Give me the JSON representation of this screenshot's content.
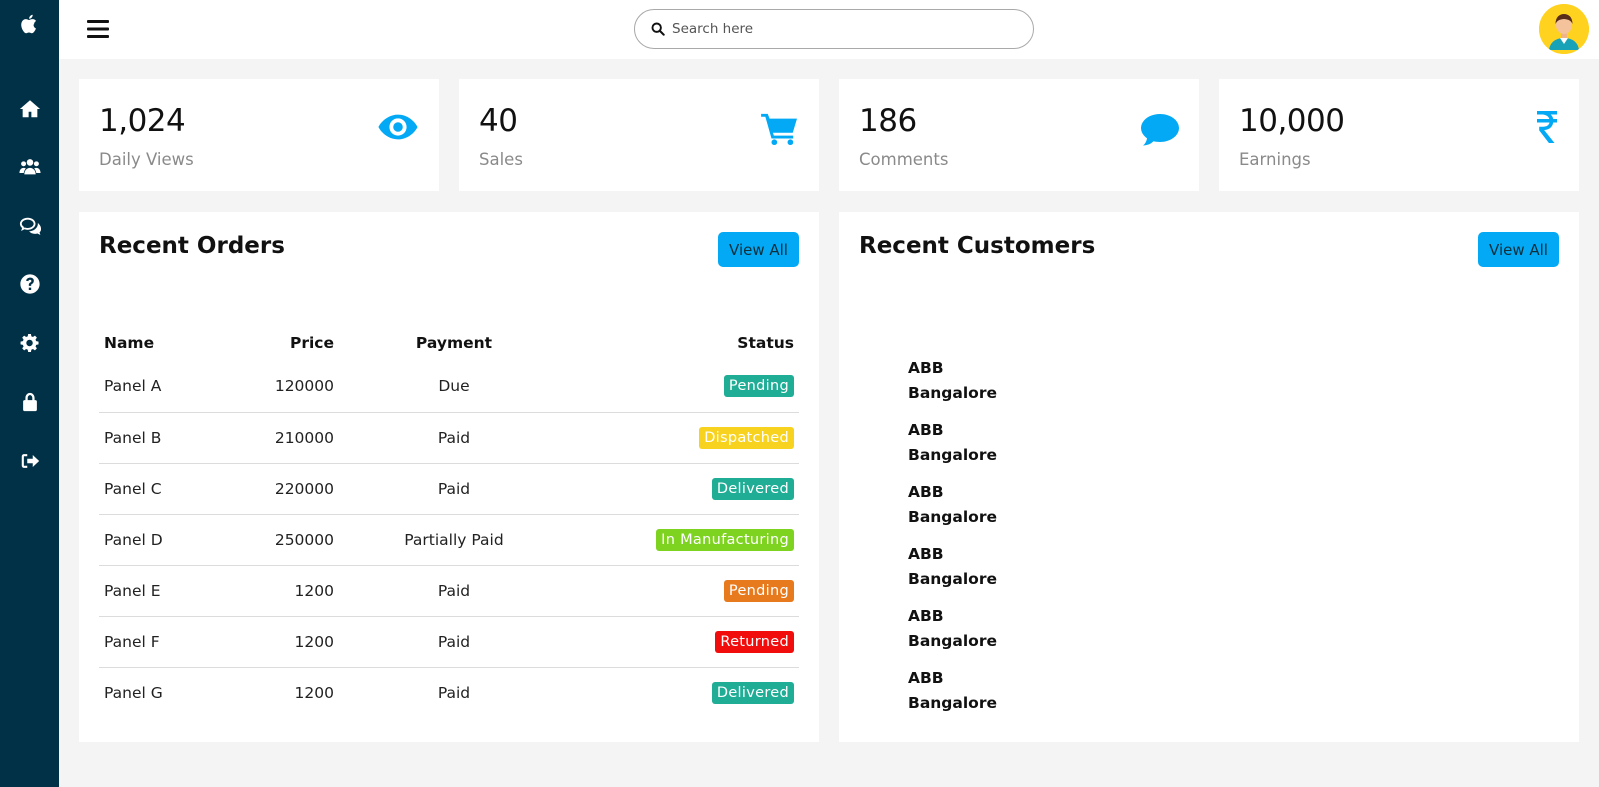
{
  "sidebar": {
    "logo_icon": "apple-logo-icon",
    "items": [
      {
        "name": "home",
        "icon": "home-icon"
      },
      {
        "name": "customers",
        "icon": "users-icon"
      },
      {
        "name": "messages",
        "icon": "comments-icon"
      },
      {
        "name": "help",
        "icon": "help-icon"
      },
      {
        "name": "settings",
        "icon": "gear-icon"
      },
      {
        "name": "password",
        "icon": "lock-icon"
      },
      {
        "name": "sign-out",
        "icon": "sign-out-icon"
      }
    ]
  },
  "topbar": {
    "search_placeholder": "Search here"
  },
  "cards": [
    {
      "number": "1,024",
      "label": "Daily Views",
      "icon": "eye-icon"
    },
    {
      "number": "40",
      "label": "Sales",
      "icon": "cart-icon"
    },
    {
      "number": "186",
      "label": "Comments",
      "icon": "chat-icon"
    },
    {
      "number": "10,000",
      "label": "Earnings",
      "icon": "rupee-icon"
    }
  ],
  "recent_orders": {
    "title": "Recent Orders",
    "view_all": "View All",
    "headers": {
      "name": "Name",
      "price": "Price",
      "payment": "Payment",
      "status": "Status"
    },
    "rows": [
      {
        "name": "Panel A",
        "price": "120000",
        "payment": "Due",
        "status": "Pending",
        "status_color": "#1fad96"
      },
      {
        "name": "Panel B",
        "price": "210000",
        "payment": "Paid",
        "status": "Dispatched",
        "status_color": "#f7d21e"
      },
      {
        "name": "Panel C",
        "price": "220000",
        "payment": "Paid",
        "status": "Delivered",
        "status_color": "#1fad96"
      },
      {
        "name": "Panel D",
        "price": "250000",
        "payment": "Partially Paid",
        "status": "In Manufacturing",
        "status_color": "#7ed321"
      },
      {
        "name": "Panel E",
        "price": "1200",
        "payment": "Paid",
        "status": "Pending",
        "status_color": "#e87a1e"
      },
      {
        "name": "Panel F",
        "price": "1200",
        "payment": "Paid",
        "status": "Returned",
        "status_color": "#f20d0d"
      },
      {
        "name": "Panel G",
        "price": "1200",
        "payment": "Paid",
        "status": "Delivered",
        "status_color": "#1fad96"
      }
    ]
  },
  "recent_customers": {
    "title": "Recent Customers",
    "view_all": "View All",
    "items": [
      {
        "name": "ABB",
        "city": "Bangalore"
      },
      {
        "name": "ABB",
        "city": "Bangalore"
      },
      {
        "name": "ABB",
        "city": "Bangalore"
      },
      {
        "name": "ABB",
        "city": "Bangalore"
      },
      {
        "name": "ABB",
        "city": "Bangalore"
      },
      {
        "name": "ABB",
        "city": "Bangalore"
      }
    ]
  },
  "colors": {
    "sidebar": "#003147",
    "accent": "#03a9f4",
    "background": "#f4f4f4"
  }
}
